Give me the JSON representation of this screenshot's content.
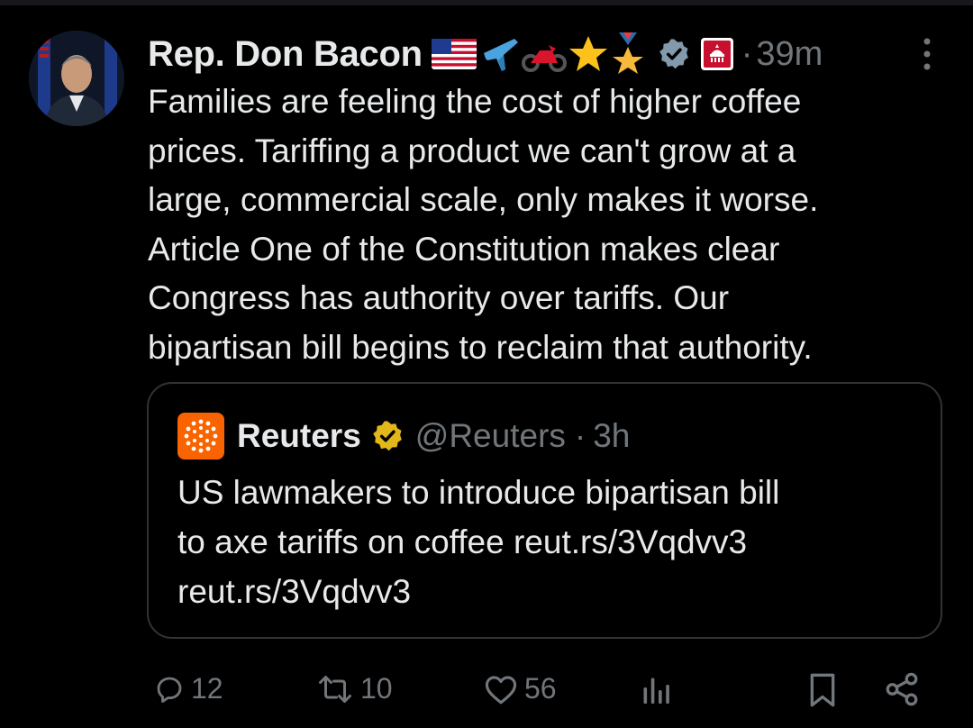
{
  "tweet": {
    "author_name": "Rep. Don Bacon",
    "name_emojis": [
      "us-flag",
      "airplane",
      "motorcycle",
      "star",
      "military-medal"
    ],
    "separator": "·",
    "time": "39m",
    "text": "Families are feeling the cost of higher coffee\nprices. Tariffing a product we can't grow at a\nlarge, commercial scale, only makes it worse.\nArticle One of the Constitution makes clear\nCongress has authority over tariffs. Our\nbipartisan bill begins to reclaim that authority."
  },
  "quoted": {
    "author_name": "Reuters",
    "handle": "@Reuters",
    "separator": "·",
    "time": "3h",
    "text": "US lawmakers to introduce bipartisan bill\nto axe tariffs on coffee reut.rs/3Vqdvv3\nreut.rs/3Vqdvv3"
  },
  "actions": {
    "replies": "12",
    "reposts": "10",
    "likes": "56"
  },
  "colors": {
    "background": "#000000",
    "text": "#e7e9ea",
    "muted": "#71767b",
    "border": "#2f3336",
    "verified_gray": "#829aab",
    "verified_gold": "#e2b719",
    "reuters_orange": "#fa6400"
  }
}
